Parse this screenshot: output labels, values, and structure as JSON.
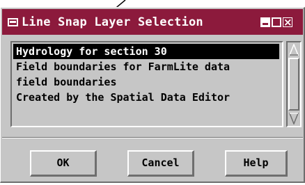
{
  "window": {
    "title": "Line Snap Layer Selection",
    "colors": {
      "titlebar": "#8c1a3c",
      "face": "#c6c6c6",
      "selection": "#000000"
    },
    "controls": [
      "menu-icon",
      "minimize-icon",
      "maximize-icon",
      "close-icon"
    ]
  },
  "list": {
    "items": [
      {
        "label": "Hydrology for section 30",
        "selected": true
      },
      {
        "label": "Field boundaries for FarmLite data",
        "selected": false
      },
      {
        "label": "field boundaries",
        "selected": false
      },
      {
        "label": "Created by the Spatial Data Editor",
        "selected": false
      }
    ]
  },
  "buttons": {
    "ok": "OK",
    "cancel": "Cancel",
    "help": "Help"
  },
  "icons": {
    "scroll_up": "scroll-up-arrow-icon",
    "scroll_down": "scroll-down-arrow-icon"
  }
}
